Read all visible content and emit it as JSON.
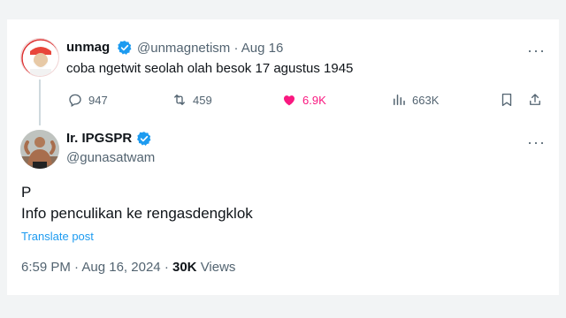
{
  "parent": {
    "name": "unmag",
    "handle": "@unmagnetism",
    "sep": "·",
    "date": "Aug 16",
    "text": "coba ngetwit seolah olah besok 17 agustus 1945",
    "replies": "947",
    "retweets": "459",
    "likes": "6.9K",
    "views": "663K",
    "more": "···"
  },
  "reply": {
    "name": "Ir. IPGSPR",
    "handle": "@gunasatwam",
    "line1": "P",
    "line2": "Info penculikan ke rengasdengklok",
    "translate": "Translate post",
    "time": "6:59 PM",
    "sep1": "·",
    "date": "Aug 16, 2024",
    "sep2": "·",
    "views_count": "30K",
    "views_label": "Views",
    "more": "···"
  },
  "colors": {
    "verified": "#1d9bf0",
    "like": "#f91880",
    "link": "#1d9bf0",
    "muted": "#536471"
  },
  "icons": [
    "reply-icon",
    "retweet-icon",
    "like-icon",
    "views-icon",
    "bookmark-icon",
    "share-icon",
    "verified-icon",
    "more-icon"
  ]
}
